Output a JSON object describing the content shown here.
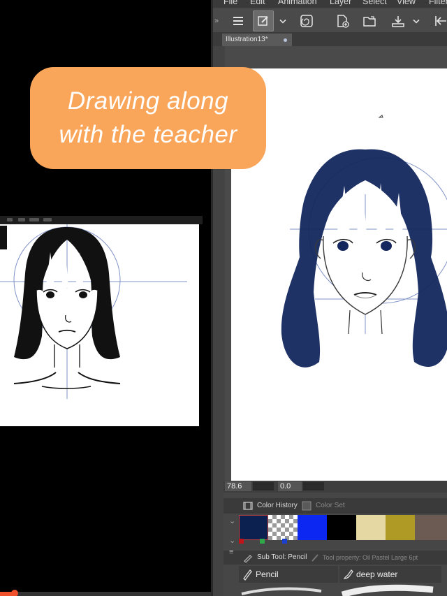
{
  "caption": {
    "line1": "Drawing along",
    "line2": "with the teacher"
  },
  "app": {
    "menu": [
      "File",
      "Edit",
      "Animation",
      "Layer",
      "Select",
      "View",
      "Filter"
    ],
    "document_tab": "Illustration13*",
    "navigator": {
      "zoom_value": "78.6",
      "rotation_value": "0.0"
    },
    "color_history_panel": {
      "tab_label": "Color History",
      "inactive_tab_label": "Color Set",
      "swatches": [
        "#0d2150",
        "transparent",
        "#0d27f2",
        "#000000",
        "#e6d8a2",
        "#b09a26",
        "#6b5b52"
      ],
      "mini_swatches": [
        "#c0141a",
        "#2ea84a",
        "#1c3fd0"
      ]
    },
    "sub_tool_panel": {
      "tab_label": "Sub Tool: Pencil",
      "property_label": "Tool property: Oil Pastel Large 6pt",
      "tools": [
        "Pencil",
        "deep water"
      ]
    }
  },
  "video": {
    "progress_fraction": 0.07
  },
  "colors": {
    "caption_bg": "#f9a55a",
    "ink_teacher": "#111111",
    "ink_student": "#13275e",
    "guide_line": "#8093c8",
    "progress": "#f0522e"
  },
  "icons": [
    "menu-icon",
    "pen-icon",
    "spiral-icon",
    "new-file-icon",
    "open-folder-icon",
    "export-icon",
    "arrow-icon",
    "film-icon",
    "palette-icon",
    "pencil-icon",
    "brush-icon"
  ]
}
